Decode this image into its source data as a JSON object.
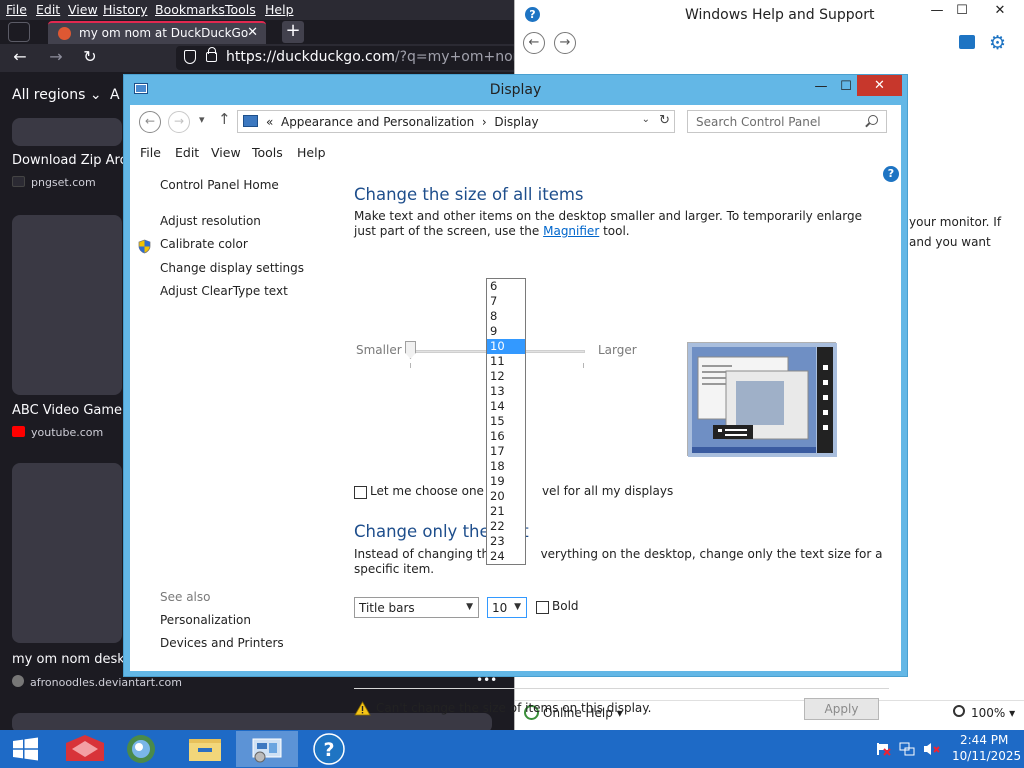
{
  "firefox": {
    "menu": [
      "File",
      "Edit",
      "View",
      "History",
      "Bookmarks",
      "Tools",
      "Help"
    ],
    "tab_title": "my om nom at DuckDuckGo",
    "tab_close": "✕",
    "new_tab": "+",
    "url_host": "https://duckduckgo.com",
    "url_path": "/?q=my+om+nom+&",
    "regions": "All regions ⌄",
    "regions2": "A",
    "results": [
      {
        "title": "Download Zip Arch",
        "source": "pngset.com"
      },
      {
        "title": "ABC Video Game w",
        "source": "youtube.com"
      },
      {
        "title": "my om nom deskto",
        "source": "afronoodles.deviantart.com"
      }
    ],
    "more": "•••"
  },
  "help": {
    "title": "Windows Help and Support",
    "body_line1": "your monitor. If",
    "body_line2": "and you want",
    "online_help": "Online Help",
    "zoom": "100%"
  },
  "display": {
    "title": "Display",
    "breadcrumb_prefix": "«",
    "breadcrumb_1": "Appearance and Personalization",
    "breadcrumb_sep": "›",
    "breadcrumb_2": "Display",
    "search_placeholder": "Search Control Panel",
    "menu": [
      "File",
      "Edit",
      "View",
      "Tools",
      "Help"
    ],
    "sidebar": {
      "home": "Control Panel Home",
      "links": [
        "Adjust resolution",
        "Calibrate color",
        "Change display settings",
        "Adjust ClearType text"
      ],
      "see_also": "See also",
      "see_also_links": [
        "Personalization",
        "Devices and Printers"
      ]
    },
    "heading1": "Change the size of all items",
    "para1_a": "Make text and other items on the desktop smaller and larger. To temporarily enlarge just part of the screen, use the ",
    "para1_link": "Magnifier",
    "para1_b": " tool.",
    "slider_smaller": "Smaller",
    "slider_larger": "Larger",
    "scale_checkbox_a": "Let me choose one sca",
    "scale_checkbox_b": "vel for all my displays",
    "heading2_a": "Change only the te",
    "heading2_b": "xt",
    "para2_a": "Instead of changing the s",
    "para2_b": "verything on the desktop, change only the text size for a specific item.",
    "item_select": "Title bars",
    "size_select": "10",
    "bold_label": "Bold",
    "warning": "Can't change the size of items on this display.",
    "apply": "Apply",
    "font_sizes": [
      "6",
      "7",
      "8",
      "9",
      "10",
      "11",
      "12",
      "13",
      "14",
      "15",
      "16",
      "17",
      "18",
      "19",
      "20",
      "21",
      "22",
      "23",
      "24"
    ],
    "selected_size": "10"
  },
  "taskbar": {
    "time": "2:44 PM",
    "date": "10/11/2025"
  },
  "colors": {
    "accent": "#3399ff",
    "title_active": "#63b7e6",
    "taskbar": "#1e6ac6",
    "heading": "#1e4e8c",
    "close_button": "#c7372c"
  }
}
